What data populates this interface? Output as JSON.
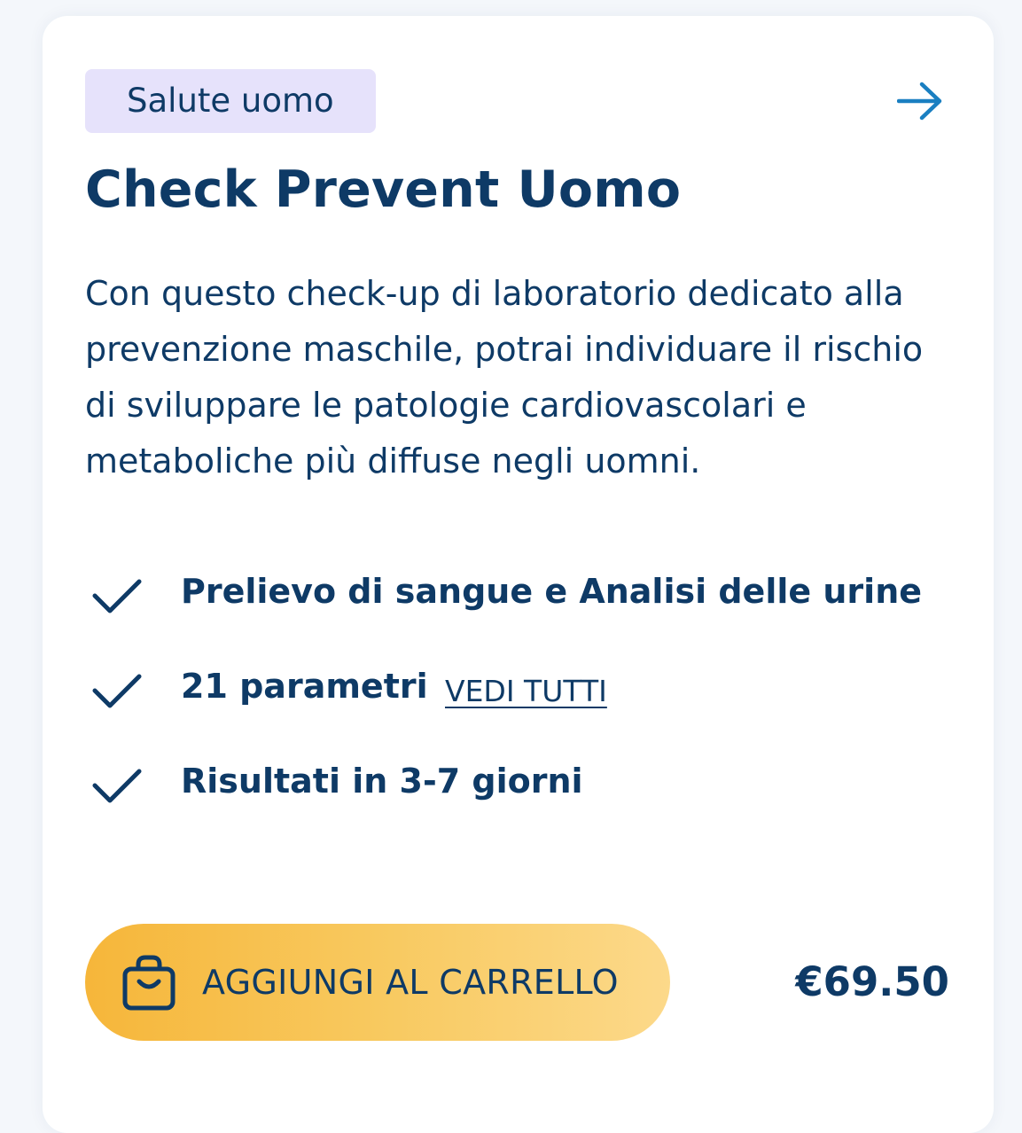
{
  "card": {
    "badge": "Salute uomo",
    "arrow_icon": "arrow-right-icon",
    "title": "Check Prevent Uomo",
    "description": "Con questo check-up di laboratorio dedicato alla prevenzione maschile, potrai individuare il rischio di sviluppare le patologie cardiovascolari e metaboliche più diffuse negli uomni.",
    "features": [
      {
        "icon": "checkmark-icon",
        "text": "Prelievo di sangue e Analisi delle urine"
      },
      {
        "icon": "checkmark-icon",
        "text": "21 parametri",
        "link": "VEDI TUTTI"
      },
      {
        "icon": "checkmark-icon",
        "text": "Risultati in 3-7 giorni"
      }
    ],
    "cart_button": {
      "icon": "shopping-bag-icon",
      "label": "AGGIUNGI AL CARRELLO"
    },
    "price": "€69.50"
  },
  "colors": {
    "text_primary": "#0e3a66",
    "accent_blue": "#1a7fc1",
    "badge_bg": "#e6e2fb",
    "button_gradient_start": "#f6b63a",
    "button_gradient_end": "#fcd98a",
    "page_bg": "#f4f7fb",
    "card_bg": "#ffffff"
  }
}
